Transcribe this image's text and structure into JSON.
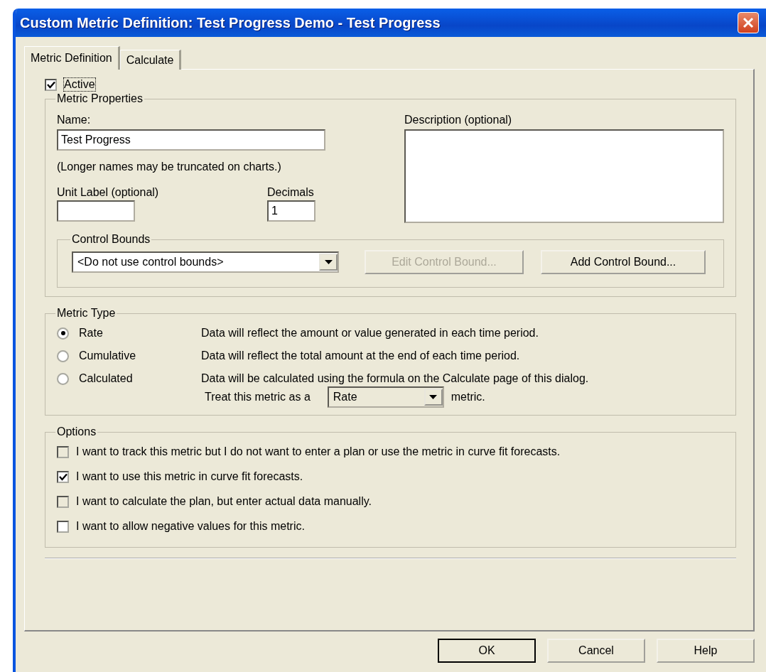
{
  "window": {
    "title": "Custom Metric Definition: Test Progress Demo - Test Progress"
  },
  "tabs": [
    {
      "label": "Metric Definition",
      "selected": true
    },
    {
      "label": "Calculate",
      "selected": false
    }
  ],
  "active": {
    "label": "Active",
    "checked": true
  },
  "metric_properties": {
    "title": "Metric Properties",
    "name_label": "Name:",
    "name_value": "Test Progress",
    "name_hint": "(Longer names may be truncated on charts.)",
    "unit_label": "Unit Label (optional)",
    "decimals_label": "Decimals",
    "decimals_value": "1",
    "description_label": "Description (optional)",
    "control_bounds": {
      "title": "Control Bounds",
      "select_value": "<Do not use control bounds>",
      "buttons": [
        {
          "label": "Edit Control Bound...",
          "disabled": true
        },
        {
          "label": "Add Control Bound...",
          "disabled": false
        }
      ]
    }
  },
  "metric_type": {
    "title": "Metric Type",
    "options": [
      {
        "label": "Rate",
        "description": "Data will reflect the amount or value generated in each time period.",
        "selected": true
      },
      {
        "label": "Cumulative",
        "description": "Data will reflect the total amount at the end of each time period.",
        "selected": false
      },
      {
        "label": "Calculated",
        "description": "Data will be calculated using the formula on the Calculate page of this dialog.",
        "selected": false
      }
    ],
    "treat_prefix": "Treat this metric as a",
    "treat_value": "Rate",
    "treat_suffix": "metric."
  },
  "options": {
    "title": "Options",
    "items": [
      {
        "label": "I want to track this metric but I do not want to enter a plan or use the metric in curve fit forecasts.",
        "checked": false,
        "disabled": true
      },
      {
        "label": "I want to use this metric in curve fit forecasts.",
        "checked": true,
        "disabled": false
      },
      {
        "label": "I want to calculate the plan, but enter actual data manually.",
        "checked": false,
        "disabled": true
      },
      {
        "label": "I want to allow negative values for this metric.",
        "checked": false,
        "disabled": false
      }
    ]
  },
  "buttons": [
    "OK",
    "Cancel",
    "Help"
  ]
}
